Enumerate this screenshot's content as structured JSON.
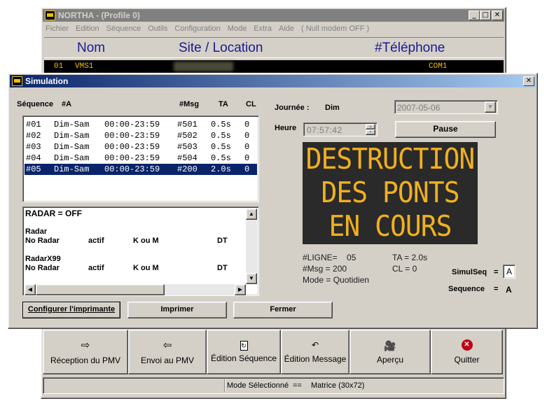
{
  "main": {
    "title": "NORTHA - (Profile  0)",
    "menu": [
      "Fichier",
      "Edition",
      "Séquence",
      "Outils",
      "Configuration",
      "Mode",
      "Extra",
      "Aide",
      "( Null modem OFF )"
    ],
    "headers": {
      "nom": "Nom",
      "site": "Site / Location",
      "tel": "#Téléphone"
    },
    "row": {
      "num": "01",
      "name": "VMS1",
      "port": "COM1"
    },
    "buttons": [
      "Réception du PMV",
      "Envoi au PMV",
      "Édition Séquence",
      "Édition Message",
      "Aperçu",
      "Quitter"
    ],
    "status": {
      "label": "Mode Sélectionné",
      "sep": "==",
      "value": "Matrice (30x72)"
    }
  },
  "sim": {
    "title": "Simulation",
    "seq_label": "Séquence",
    "seq_id": "#A",
    "col_msg": "#Msg",
    "col_ta": "TA",
    "col_cl": "CL",
    "rows": [
      {
        "num": "#01",
        "days": "Dim-Sam",
        "time": "00:00-23:59",
        "msg": "#501",
        "ta": "0.5s",
        "cl": "0"
      },
      {
        "num": "#02",
        "days": "Dim-Sam",
        "time": "00:00-23:59",
        "msg": "#502",
        "ta": "0.5s",
        "cl": "0"
      },
      {
        "num": "#03",
        "days": "Dim-Sam",
        "time": "00:00-23:59",
        "msg": "#503",
        "ta": "0.5s",
        "cl": "0"
      },
      {
        "num": "#04",
        "days": "Dim-Sam",
        "time": "00:00-23:59",
        "msg": "#504",
        "ta": "0.5s",
        "cl": "0"
      },
      {
        "num": "#05",
        "days": "Dim-Sam",
        "time": "00:00-23:59",
        "msg": "#200",
        "ta": "2.0s",
        "cl": "0"
      }
    ],
    "radar": {
      "line1": "RADAR = OFF",
      "g1": "Radar",
      "g2": "RadarX99",
      "r_name": "No Radar",
      "r_actif": "actif",
      "r_k": "K ou M",
      "r_dt": "DT"
    },
    "buttons": {
      "config": "Configurer l'imprimante",
      "print": "Imprimer",
      "close": "Fermer"
    },
    "journee_label": "Journée :",
    "journee_value": "Dim",
    "date": "2007-05-06",
    "heure_label": "Heure",
    "heure_value": "07:57:42",
    "pause": "Pause",
    "sign": [
      "DESTRUCTION",
      "DES PONTS",
      "EN COURS"
    ],
    "info": {
      "ligne": "#LIGNE=    05",
      "msg": "#Msg = 200",
      "mode": "Mode = Quotidien",
      "ta": "TA = 2.0s",
      "cl": "CL = 0"
    },
    "simulseq_label": "SimulSeq",
    "simulseq_value": "A",
    "sequence_label": "Sequence",
    "sequence_value": "A",
    "eq": "="
  }
}
